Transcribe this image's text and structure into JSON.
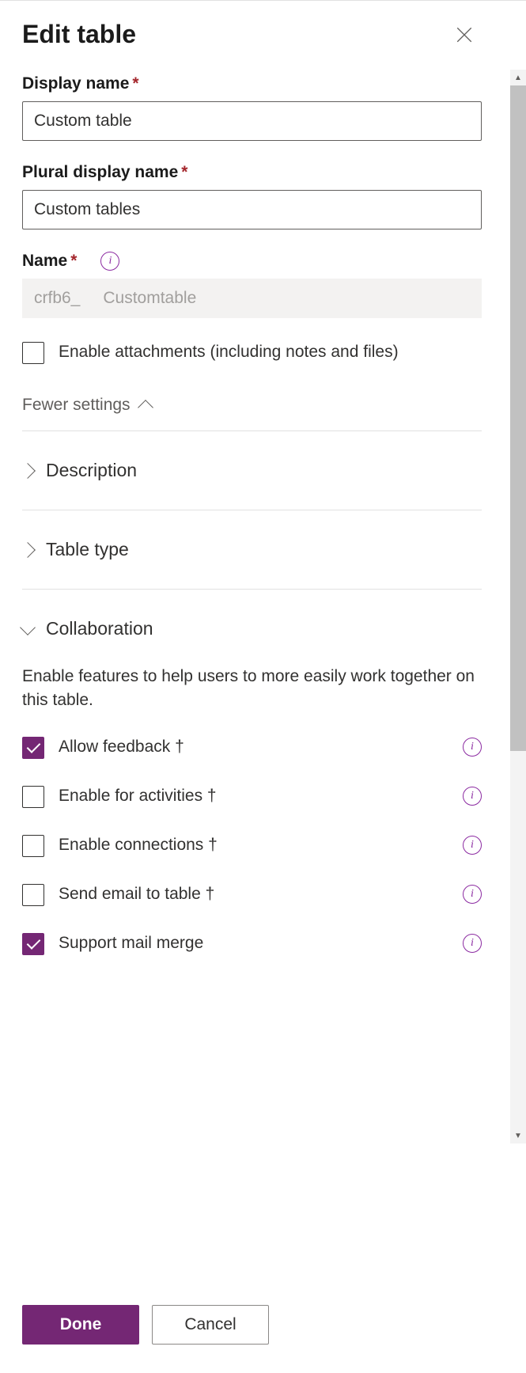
{
  "panel": {
    "title": "Edit table"
  },
  "form": {
    "displayName": {
      "label": "Display name",
      "value": "Custom table"
    },
    "pluralDisplayName": {
      "label": "Plural display name",
      "value": "Custom tables"
    },
    "name": {
      "label": "Name",
      "prefix": "crfb6_",
      "value": "Customtable"
    },
    "enableAttachments": {
      "label": "Enable attachments (including notes and files)"
    }
  },
  "settings": {
    "toggleLabel": "Fewer settings",
    "description": {
      "title": "Description"
    },
    "tableType": {
      "title": "Table type"
    },
    "collaboration": {
      "title": "Collaboration",
      "desc": "Enable features to help users to more easily work together on this table.",
      "options": [
        {
          "label": "Allow feedback †",
          "checked": true,
          "hasInfo": true
        },
        {
          "label": "Enable for activities †",
          "checked": false,
          "hasInfo": true
        },
        {
          "label": "Enable connections †",
          "checked": false,
          "hasInfo": true
        },
        {
          "label": "Send email to table †",
          "checked": false,
          "hasInfo": true
        },
        {
          "label": "Support mail merge",
          "checked": true,
          "hasInfo": true
        }
      ]
    }
  },
  "footer": {
    "done": "Done",
    "cancel": "Cancel"
  }
}
